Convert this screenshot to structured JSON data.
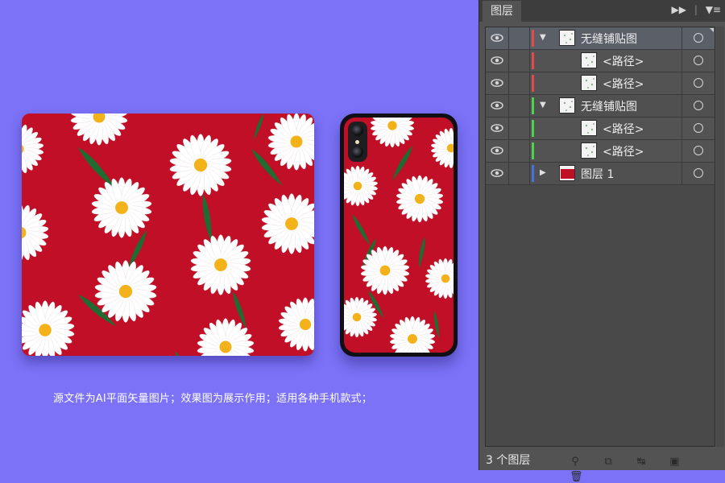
{
  "caption": "源文件为AI平面矢量图片；效果图为展示作用；适用各种手机款式；",
  "colors": {
    "background": "#7b72f7",
    "pattern_red": "#c00f26",
    "petal": "#ffffff",
    "center": "#f3b21a",
    "leaf": "#1f6b32",
    "panel": "#535353"
  },
  "layers_panel": {
    "tab_label": "图层",
    "menu_icons": [
      "double-arrow-icon",
      "panel-menu-icon"
    ],
    "layers": [
      {
        "name": "无缝铺贴图",
        "color": "#e04b4b",
        "expanded": true,
        "sublayer": false,
        "selected": true
      },
      {
        "name": "<路径>",
        "color": "#e04b4b",
        "sublayer": true
      },
      {
        "name": "<路径>",
        "color": "#e04b4b",
        "sublayer": true
      },
      {
        "name": "无缝铺贴图",
        "color": "#4fd34f",
        "expanded": true,
        "sublayer": false
      },
      {
        "name": "<路径>",
        "color": "#4fd34f",
        "sublayer": true
      },
      {
        "name": "<路径>",
        "color": "#4fd34f",
        "sublayer": true
      },
      {
        "name": "图层 1",
        "color": "#4a6fe0",
        "expanded": false,
        "sublayer": false
      }
    ],
    "footer": {
      "layer_count": "3 个图层",
      "icons": [
        "locate-object-icon",
        "make-clipping-mask-icon",
        "create-sublayer-icon",
        "create-new-layer-icon",
        "delete-icon"
      ]
    }
  }
}
